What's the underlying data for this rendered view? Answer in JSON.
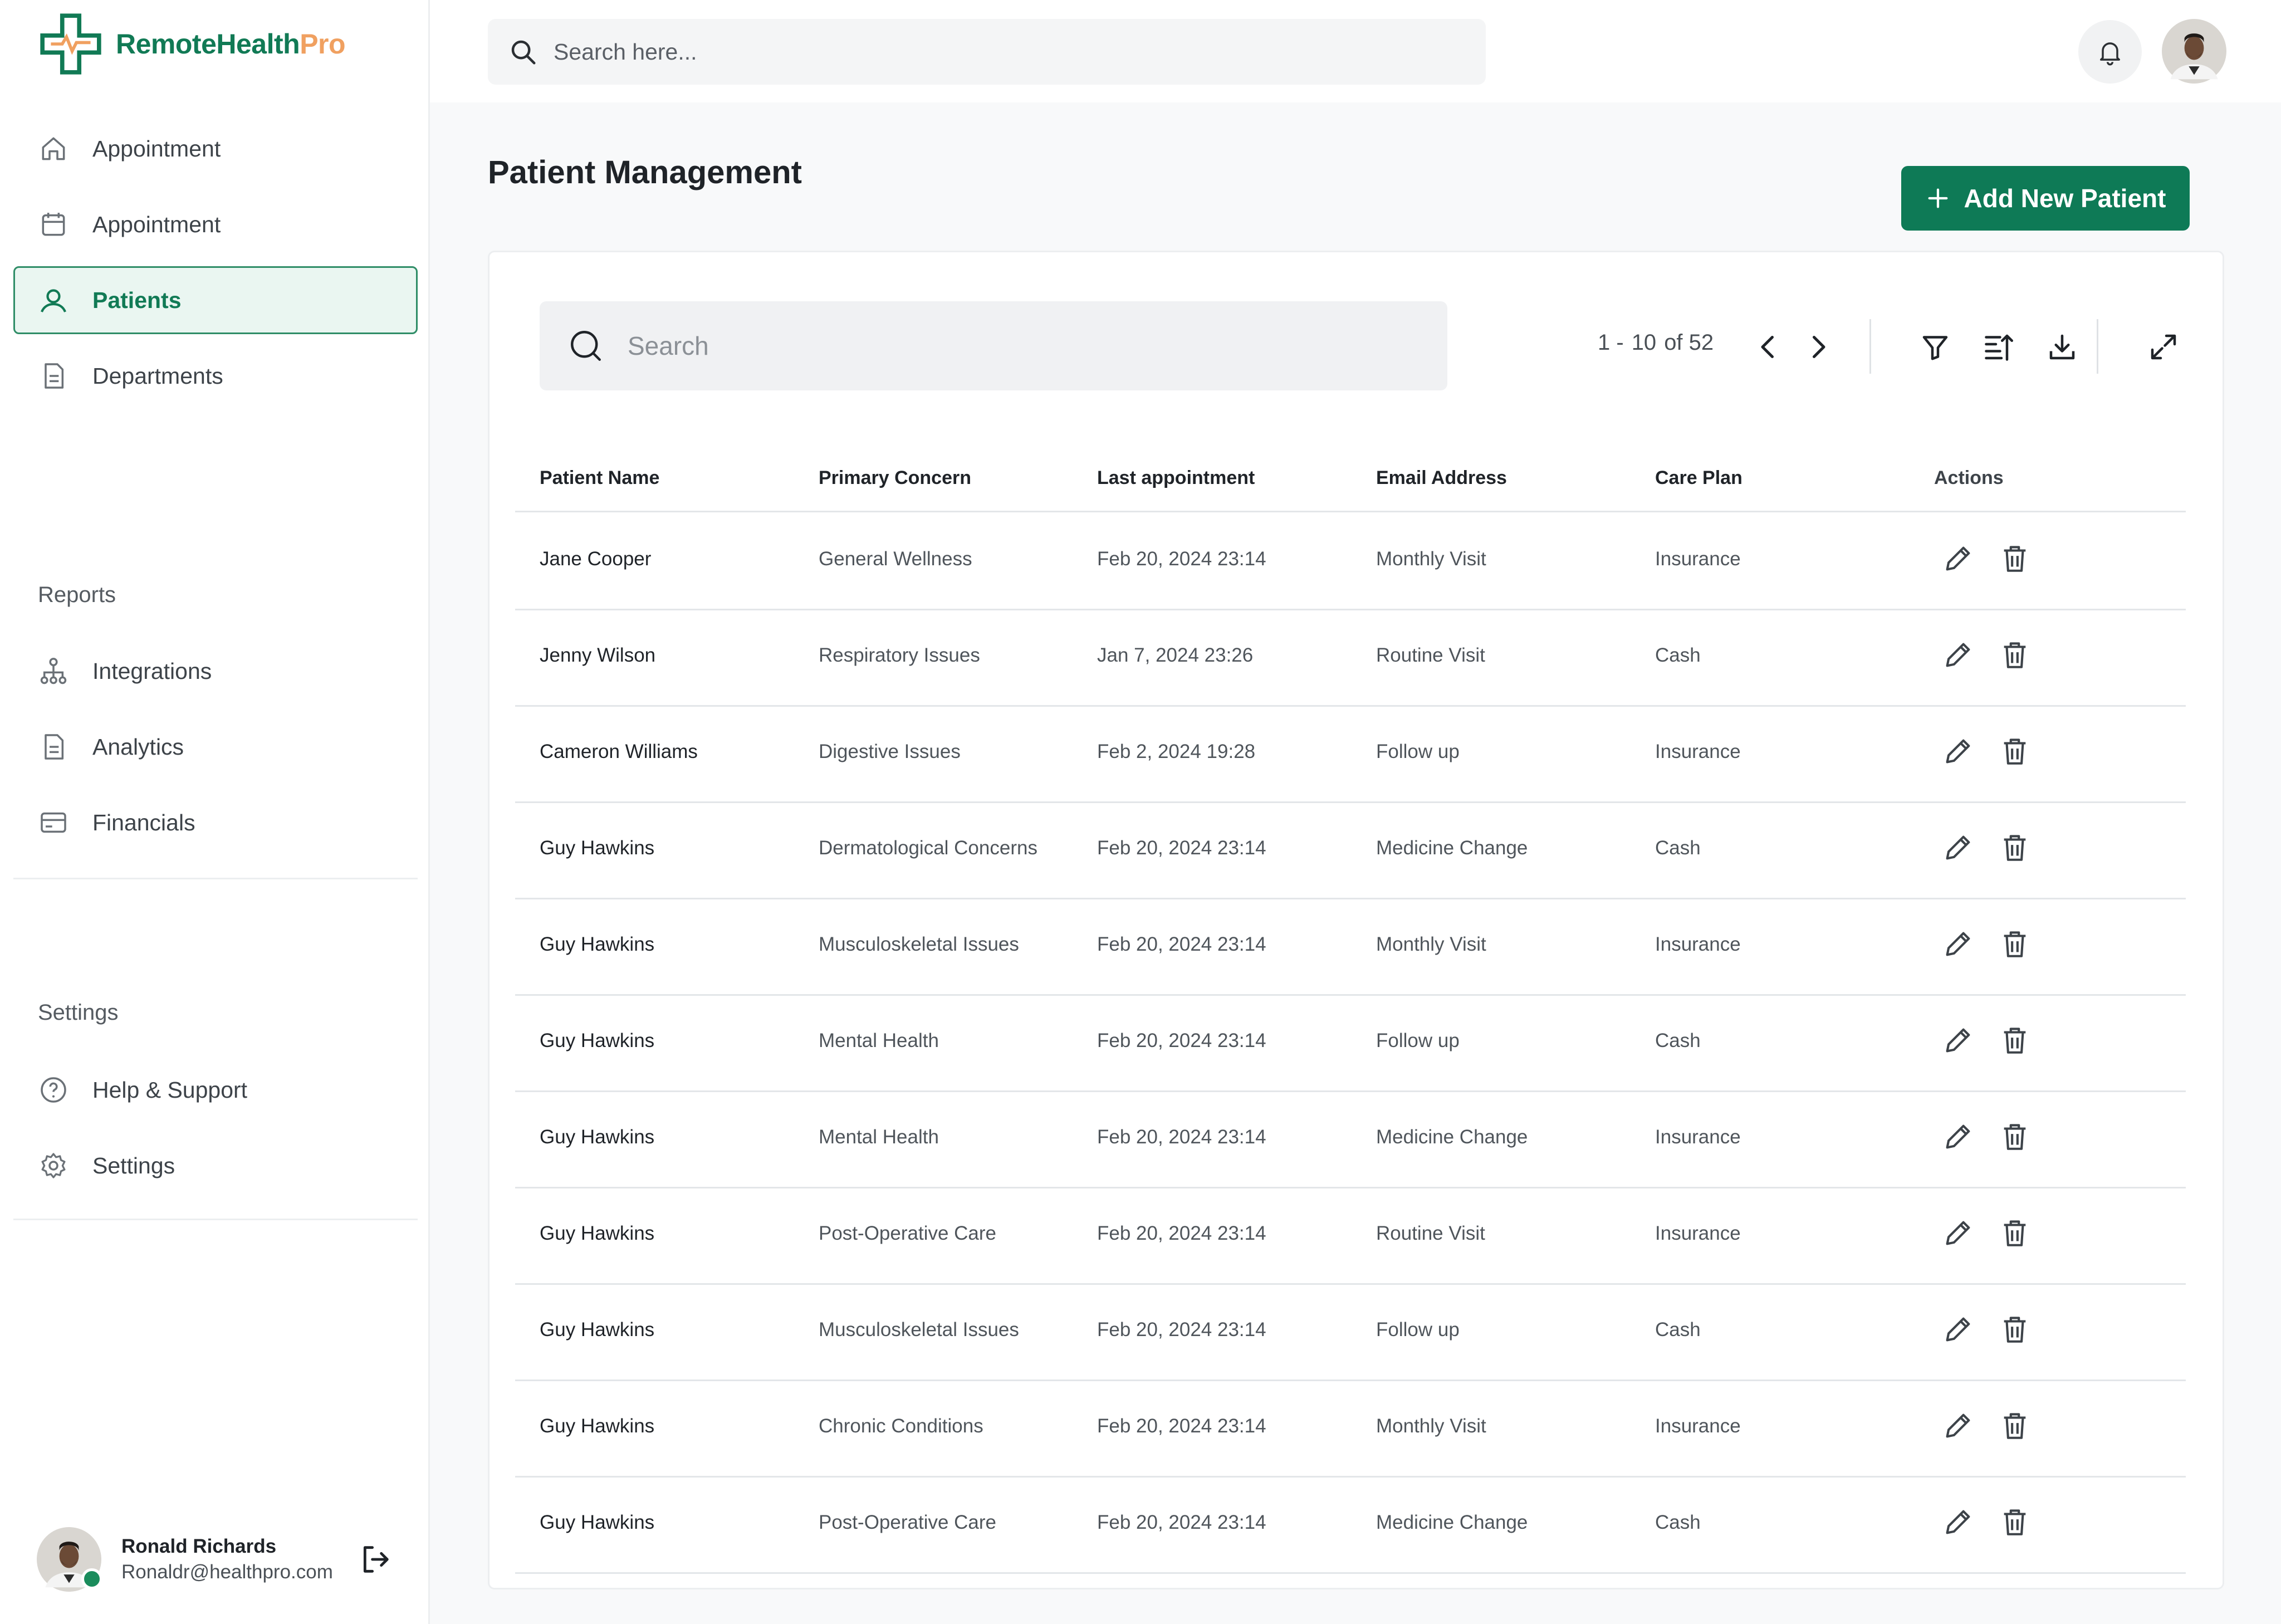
{
  "brand": {
    "name_part1": "RemoteHealth",
    "name_part2": "Pro",
    "primary_color": "#117a55",
    "accent_color": "#f0a060"
  },
  "sidebar": {
    "items": [
      {
        "label": "Appointment",
        "icon": "home-icon"
      },
      {
        "label": "Appointment",
        "icon": "calendar-icon"
      },
      {
        "label": "Patients",
        "icon": "patients-icon",
        "active": true
      },
      {
        "label": "Departments",
        "icon": "document-icon"
      }
    ],
    "reports_label": "Reports",
    "reports_items": [
      {
        "label": "Integrations",
        "icon": "hierarchy-icon"
      },
      {
        "label": "Analytics",
        "icon": "document-icon"
      },
      {
        "label": "Financials",
        "icon": "card-icon"
      }
    ],
    "settings_label": "Settings",
    "settings_items": [
      {
        "label": "Help & Support",
        "icon": "help-icon"
      },
      {
        "label": "Settings",
        "icon": "gear-icon"
      }
    ],
    "user": {
      "name": "Ronald Richards",
      "email": "Ronaldr@healthpro.com",
      "status": "online"
    }
  },
  "topbar": {
    "search_placeholder": "Search here..."
  },
  "page": {
    "title": "Patient Management",
    "add_button_label": "Add New Patient"
  },
  "table": {
    "search_placeholder": "Search",
    "pagination": {
      "range_start": "1 -",
      "range_end": "10",
      "total": "of 52"
    },
    "columns": [
      "Patient Name",
      "Primary Concern",
      "Last appointment",
      "Email Address",
      "Care Plan",
      "Actions"
    ],
    "rows": [
      {
        "name": "Jane Cooper",
        "concern": "General Wellness",
        "last": "Feb 20, 2024 23:14",
        "email": "Monthly Visit",
        "plan": "Insurance"
      },
      {
        "name": "Jenny Wilson",
        "concern": "Respiratory Issues",
        "last": "Jan 7, 2024 23:26",
        "email": "Routine Visit",
        "plan": "Cash"
      },
      {
        "name": "Cameron Williams",
        "concern": "Digestive Issues",
        "last": "Feb 2, 2024 19:28",
        "email": "Follow up",
        "plan": "Insurance"
      },
      {
        "name": "Guy Hawkins",
        "concern": "Dermatological Concerns",
        "last": "Feb 20, 2024 23:14",
        "email": "Medicine Change",
        "plan": "Cash"
      },
      {
        "name": "Guy Hawkins",
        "concern": "Musculoskeletal Issues",
        "last": "Feb 20, 2024 23:14",
        "email": "Monthly Visit",
        "plan": "Insurance"
      },
      {
        "name": "Guy Hawkins",
        "concern": "Mental Health",
        "last": "Feb 20, 2024 23:14",
        "email": "Follow up",
        "plan": "Cash"
      },
      {
        "name": "Guy Hawkins",
        "concern": "Mental Health",
        "last": "Feb 20, 2024 23:14",
        "email": "Medicine Change",
        "plan": "Insurance"
      },
      {
        "name": "Guy Hawkins",
        "concern": "Post-Operative Care",
        "last": "Feb 20, 2024 23:14",
        "email": "Routine Visit",
        "plan": "Insurance"
      },
      {
        "name": "Guy Hawkins",
        "concern": "Musculoskeletal Issues",
        "last": "Feb 20, 2024 23:14",
        "email": "Follow up",
        "plan": "Cash"
      },
      {
        "name": "Guy Hawkins",
        "concern": "Chronic Conditions",
        "last": "Feb 20, 2024 23:14",
        "email": "Monthly Visit",
        "plan": "Insurance"
      },
      {
        "name": "Guy Hawkins",
        "concern": "Post-Operative Care",
        "last": "Feb 20, 2024 23:14",
        "email": "Medicine Change",
        "plan": "Cash"
      }
    ]
  }
}
